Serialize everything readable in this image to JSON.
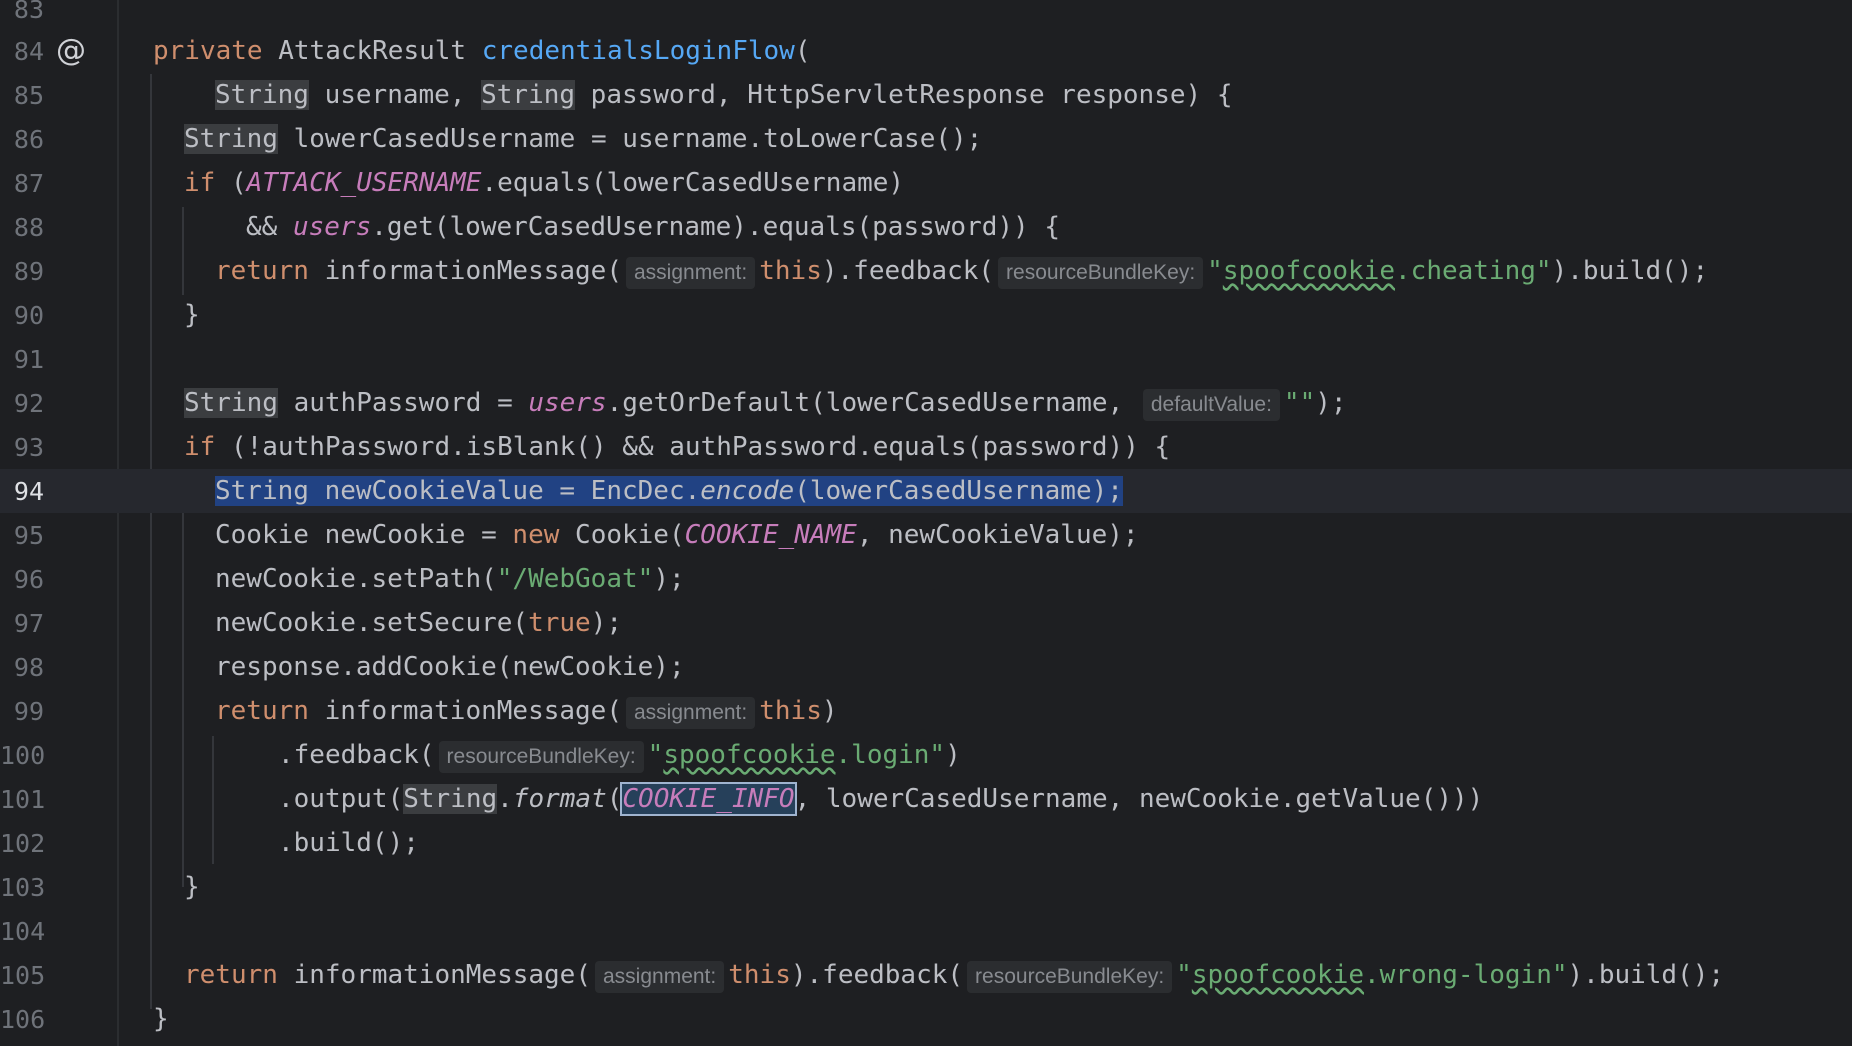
{
  "editor": {
    "colors": {
      "background": "#1e1f22",
      "keyword": "#cf8e6d",
      "function": "#56a8f5",
      "constant": "#c77dbb",
      "string": "#6aab73",
      "selection": "#214283"
    },
    "line_numbers": [
      "83",
      "84",
      "85",
      "86",
      "87",
      "88",
      "89",
      "90",
      "91",
      "92",
      "93",
      "94",
      "95",
      "96",
      "97",
      "98",
      "99",
      "100",
      "101",
      "102",
      "103",
      "104",
      "105",
      "106"
    ],
    "current_line": "94",
    "gutter_marker": {
      "line": "84",
      "symbol": "@",
      "icon": "at-sign-override-icon"
    },
    "hints": {
      "assignment": "assignment:",
      "resourceBundleKey": "resourceBundleKey:",
      "defaultValue": "defaultValue:"
    },
    "tokens": {
      "private": "private",
      "AttackResult": "AttackResult",
      "credentialsLoginFlow": "credentialsLoginFlow",
      "open_paren": "(",
      "String": "String",
      "username_param": " username, ",
      "password_param": " password, HttpServletResponse response) {",
      "l86_rest": " lowerCasedUsername = username.toLowerCase();",
      "if": "if",
      "l87_open": " (",
      "ATTACK_USERNAME": "ATTACK_USERNAME",
      "l87_rest": ".equals(lowerCasedUsername)",
      "l88_and": "&& ",
      "users": "users",
      "l88_rest": ".get(lowerCasedUsername).equals(password)) {",
      "return": "return",
      "informationMessage_open": " informationMessage(",
      "this": "this",
      "feedback_open": ").feedback(",
      "str_quote_open": "\"",
      "spoofcookie": "spoofcookie",
      "cheating_rest": ".cheating\"",
      "build_end": ").build();",
      "close_brace": "}",
      "l92_rest": " authPassword = ",
      "getOrDefault_part": ".getOrDefault(lowerCasedUsername,",
      "empty_str": "\"\"",
      "semi_end": ");",
      "l93_rest": " (!authPassword.isBlank() && authPassword.equals(password)) {",
      "l94_a": "String newCookieValue = EncDec.",
      "encode": "encode",
      "l94_b": "(lowerCasedUsername);",
      "l95_a": "Cookie newCookie = ",
      "new": "new",
      "l95_b": " Cookie(",
      "COOKIE_NAME": "COOKIE_NAME",
      "l95_c": ", newCookieValue);",
      "l96_a": "newCookie.setPath(",
      "webgoat_str": "\"/WebGoat\"",
      "l97_a": "newCookie.setSecure(",
      "true": "true",
      "l98": "response.addCookie(newCookie);",
      "close_paren": ")",
      "feedback_line_open": ".feedback(",
      "login_rest": ".login\"",
      "output_open": ".output(",
      "dot": ".",
      "format": "format",
      "COOKIE_INFO": "COOKIE_INFO",
      "l101_rest": ", lowerCasedUsername, newCookie.getValue()))",
      "build_line": ".build();",
      "wrong_login_rest": ".wrong-login\""
    }
  }
}
